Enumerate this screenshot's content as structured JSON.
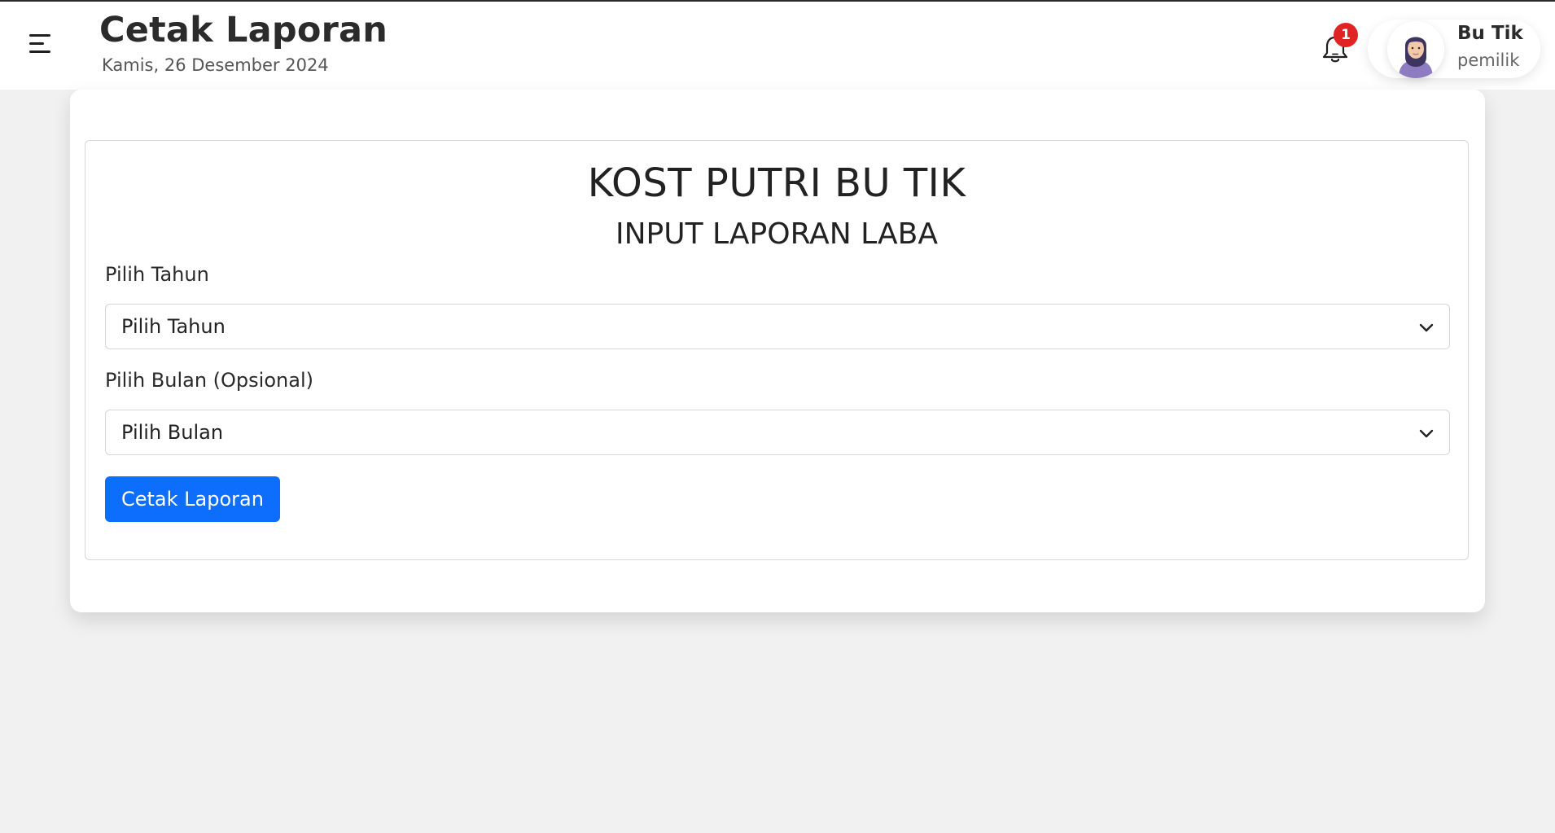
{
  "header": {
    "title": "Cetak Laporan",
    "date": "Kamis, 26 Desember 2024",
    "notification_count": "1",
    "user": {
      "name": "Bu Tik",
      "role": "pemilik"
    },
    "icons": {
      "menu": "hamburger-menu-icon",
      "notifications": "bell-icon",
      "avatar": "user-avatar"
    }
  },
  "report_form": {
    "heading": "KOST PUTRI BU TIK",
    "subheading": "INPUT LAPORAN LABA",
    "year_label": "Pilih Tahun",
    "year_select_value": "Pilih Tahun",
    "month_label": "Pilih Bulan (Opsional)",
    "month_select_value": "Pilih Bulan",
    "submit_label": "Cetak Laporan"
  },
  "colors": {
    "primary_button": "#0d6efd",
    "badge": "#e02424",
    "page_background": "#f1f1f1"
  }
}
